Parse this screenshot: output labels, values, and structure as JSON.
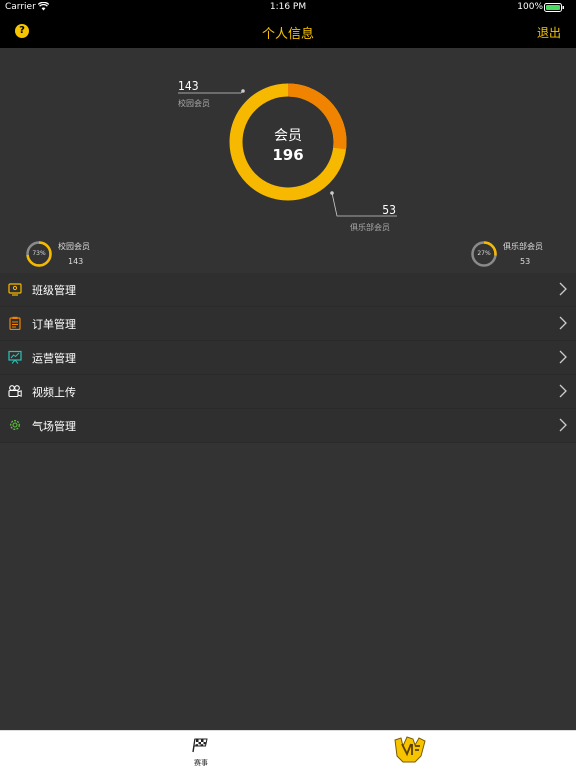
{
  "status_bar": {
    "carrier": "Carrier",
    "time": "1:16 PM",
    "battery_pct": "100%"
  },
  "nav": {
    "help_label": "?",
    "title": "个人信息",
    "logout_label": "退出"
  },
  "summary": {
    "center_label": "会员",
    "total": "196",
    "campus": {
      "count": "143",
      "label": "校园会员",
      "fraction": 0.73
    },
    "club": {
      "count": "53",
      "label": "俱乐部会员",
      "fraction": 0.27
    }
  },
  "mini": {
    "campus": {
      "pct": "73%",
      "label": "校园会员",
      "count": "143"
    },
    "club": {
      "pct": "27%",
      "label": "俱乐部会员",
      "count": "53"
    }
  },
  "menu": [
    {
      "label": "班级管理",
      "icon": "class-icon"
    },
    {
      "label": "订单管理",
      "icon": "clipboard-icon"
    },
    {
      "label": "运营管理",
      "icon": "presentation-icon"
    },
    {
      "label": "视频上传",
      "icon": "video-camera-icon"
    },
    {
      "label": "气场管理",
      "icon": "aura-gear-icon"
    }
  ],
  "tabbar": {
    "race_label": "赛事",
    "logo_icon": "brand-logo-icon"
  },
  "colors": {
    "accent": "#f7c400",
    "ring_campus": "#f7b900",
    "ring_club": "#f08400",
    "background": "#333333"
  }
}
